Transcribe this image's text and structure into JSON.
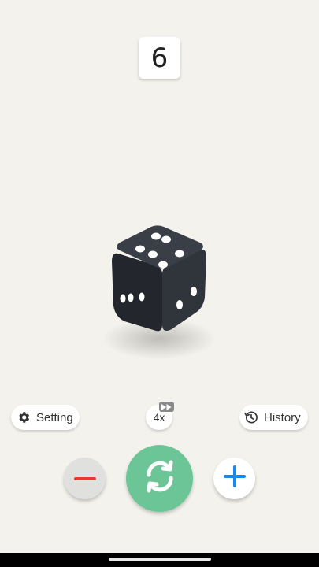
{
  "result": {
    "value": "6"
  },
  "die": {
    "top_face": 6,
    "left_face": 3,
    "right_face": 2,
    "body_color": "#2b2f36",
    "pip_color": "#ffffff"
  },
  "controls": {
    "setting_label": "Setting",
    "history_label": "History",
    "speed_label": "4x"
  },
  "icons": {
    "setting": "gear-icon",
    "history": "history-icon",
    "speed_badge": "fast-forward-icon",
    "minus": "minus-icon",
    "roll": "refresh-icon",
    "plus": "plus-icon"
  },
  "colors": {
    "background": "#f3f2ec",
    "roll_button": "#6cc596",
    "minus_mark": "#e53935",
    "plus_mark": "#1e88e5"
  }
}
